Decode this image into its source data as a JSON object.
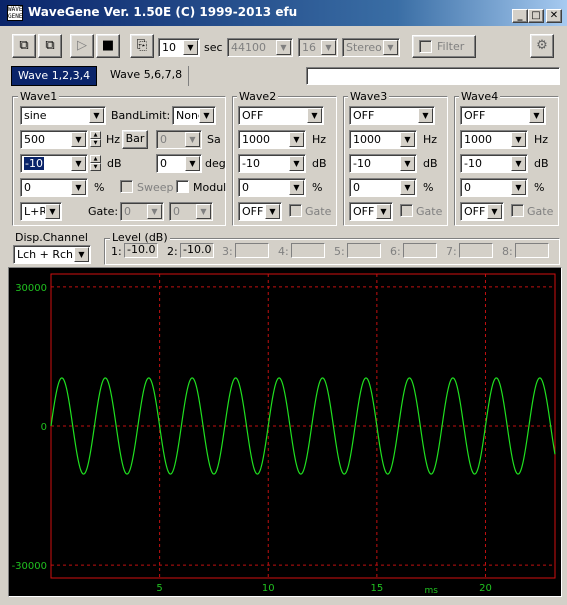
{
  "window": {
    "title": "WaveGene  Ver. 1.50E  (C) 1999-2013 efu",
    "app_icon": "WAVE GENE"
  },
  "caption": {
    "minimize": "_",
    "maximize": "□",
    "close": "✕"
  },
  "toolbar": {
    "duration": "10",
    "sec_label": "sec",
    "sample_rate": "44100",
    "bits": "16",
    "channels": "Stereo",
    "filter_label": "Filter"
  },
  "tabs": {
    "tab1": "Wave 1,2,3,4",
    "tab2": "Wave 5,6,7,8",
    "status_text": ""
  },
  "wave1": {
    "title": "Wave1",
    "waveform": "sine",
    "bandlimit_label": "BandLimit:",
    "bandlimit": "None",
    "freq": "500",
    "freq_unit": "Hz",
    "bar_button": "Bar",
    "sa_value": "0",
    "sa_unit": "Sa",
    "level": "-10",
    "level_unit": "dB",
    "phase": "0",
    "phase_unit": "deg",
    "duty": "0",
    "duty_unit": "%",
    "sweep_label": "Sweep",
    "modul_label": "Modul",
    "channel": "L+R",
    "gate_label": "Gate:",
    "gate1": "0",
    "gate2": "0"
  },
  "wave2": {
    "title": "Wave2",
    "waveform": "OFF",
    "freq": "1000",
    "freq_unit": "Hz",
    "level": "-10",
    "level_unit": "dB",
    "duty": "0",
    "duty_unit": "%",
    "channel": "OFF",
    "gate_label": "Gate"
  },
  "wave3": {
    "title": "Wave3",
    "waveform": "OFF",
    "freq": "1000",
    "freq_unit": "Hz",
    "level": "-10",
    "level_unit": "dB",
    "duty": "0",
    "duty_unit": "%",
    "channel": "OFF",
    "gate_label": "Gate"
  },
  "wave4": {
    "title": "Wave4",
    "waveform": "OFF",
    "freq": "1000",
    "freq_unit": "Hz",
    "level": "-10",
    "level_unit": "dB",
    "duty": "0",
    "duty_unit": "%",
    "channel": "OFF",
    "gate_label": "Gate"
  },
  "display": {
    "title": "Disp.Channel",
    "channel": "Lch + Rch"
  },
  "levels": {
    "title": "Level (dB)",
    "items": [
      {
        "label": "1:",
        "value": "-10.0"
      },
      {
        "label": "2:",
        "value": "-10.0"
      },
      {
        "label": "3:",
        "value": ""
      },
      {
        "label": "4:",
        "value": ""
      },
      {
        "label": "5:",
        "value": ""
      },
      {
        "label": "6:",
        "value": ""
      },
      {
        "label": "7:",
        "value": ""
      },
      {
        "label": "8:",
        "value": ""
      }
    ]
  },
  "scope": {
    "y_labels": [
      "30000",
      "0",
      "-30000"
    ],
    "x_labels": [
      "5",
      "10",
      "15",
      "20"
    ],
    "x_unit": "ms",
    "colors": {
      "background": "#000000",
      "frame": "#d01010",
      "grid": "#c01010",
      "trace": "#20e020",
      "labels": "#20c020"
    }
  },
  "chart_data": {
    "type": "line",
    "x_unit": "ms",
    "xlim": [
      0,
      23.2
    ],
    "ylim": [
      -32768,
      32768
    ],
    "y_ticks": [
      30000,
      0,
      -30000
    ],
    "x_ticks": [
      5,
      10,
      15,
      20
    ],
    "series": [
      {
        "frequency_hz": 500,
        "amplitude": 10362,
        "phase_deg": 0
      }
    ],
    "grid": true
  }
}
